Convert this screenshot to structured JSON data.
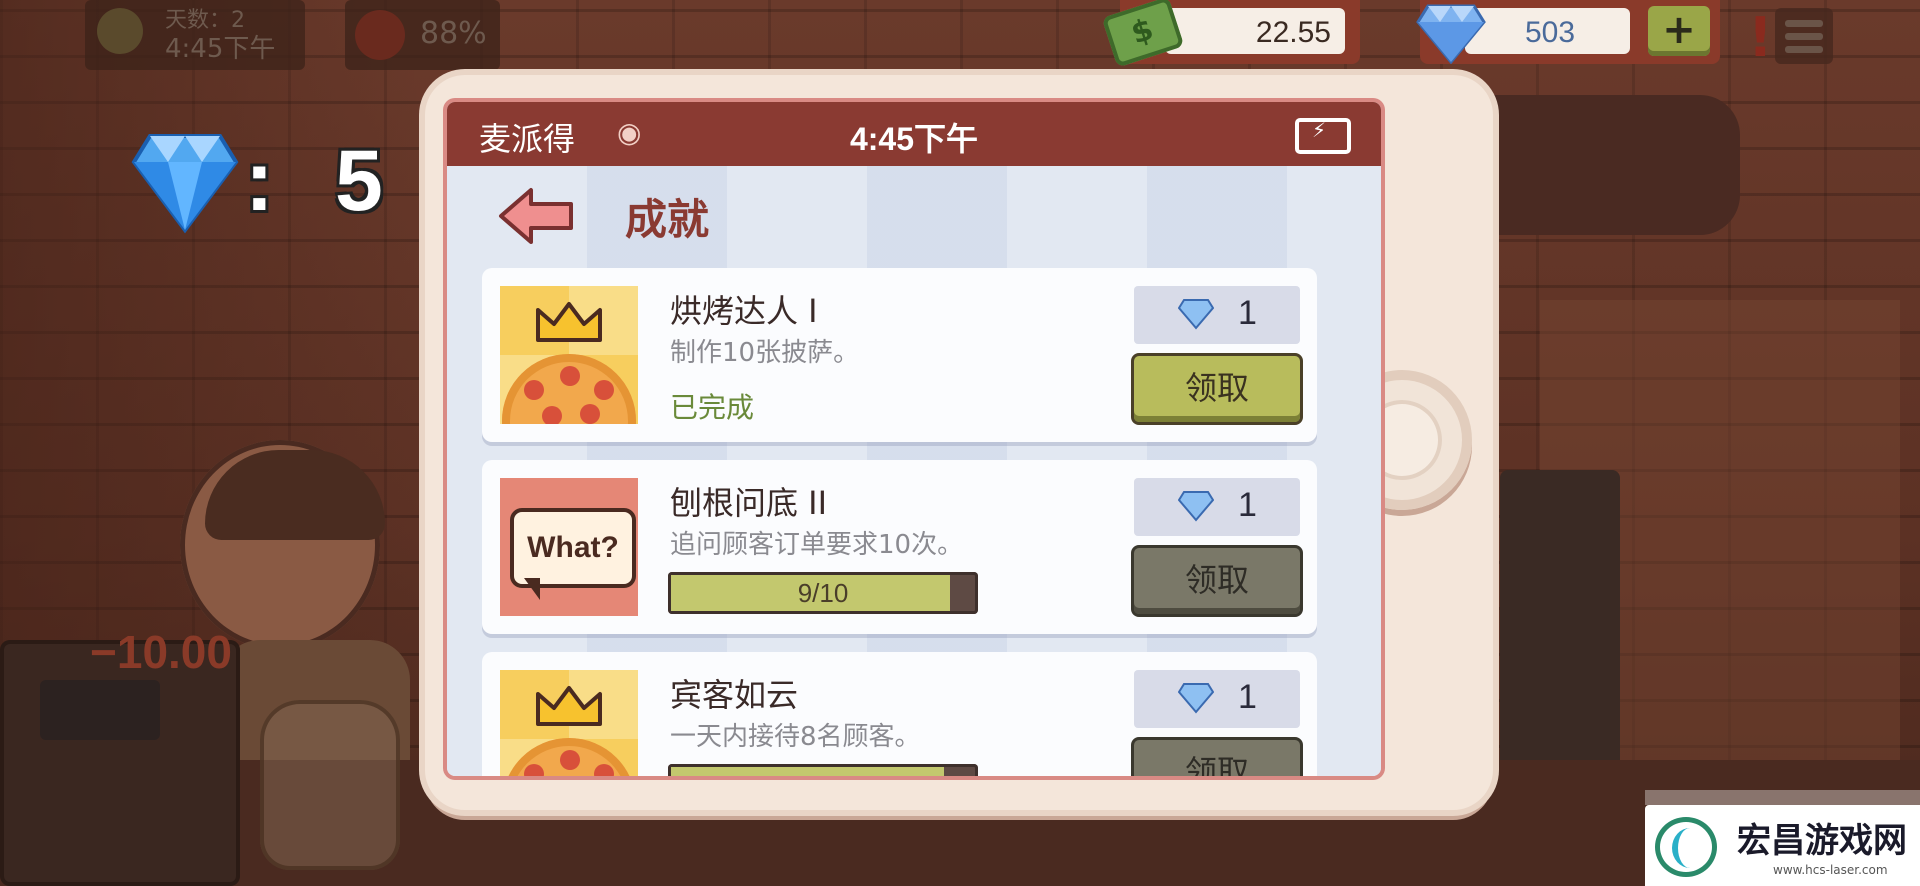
{
  "hud": {
    "day_label": "天数：2",
    "time": "4:45下午",
    "mood_pct": "88%",
    "money": "22.55",
    "gems": "503",
    "add_label": "+"
  },
  "reward": {
    "colon": ":",
    "amount": "5"
  },
  "phone": {
    "carrier": "麦派得",
    "clock": "4:45下午",
    "page_title": "成就"
  },
  "achievements": [
    {
      "name": "烘烤达人 I",
      "desc": "制作10张披萨。",
      "status": "已完成",
      "reward": "1",
      "claim_label": "领取",
      "progress": null
    },
    {
      "name": "刨根问底 II",
      "desc": "追问顾客订单要求10次。",
      "progress_text": "9/10",
      "progress": 0.9,
      "reward": "1",
      "claim_label": "领取",
      "thumb_text": "What?"
    },
    {
      "name": "宾客如云",
      "desc": "一天内接待8名顾客。",
      "progress": 0.88,
      "reward": "1",
      "claim_label": "领取"
    }
  ],
  "background": {
    "floating_text": "−10.00"
  },
  "watermark": {
    "name": "宏昌游戏网",
    "url": "www.hcs-laser.com"
  },
  "colors": {
    "status_bar": "#8a3a32",
    "claim_enabled": "#b8bc5c",
    "claim_disabled": "#7a7868",
    "progress_fill": "#c3c86e",
    "done_text": "#6a8a3a"
  }
}
